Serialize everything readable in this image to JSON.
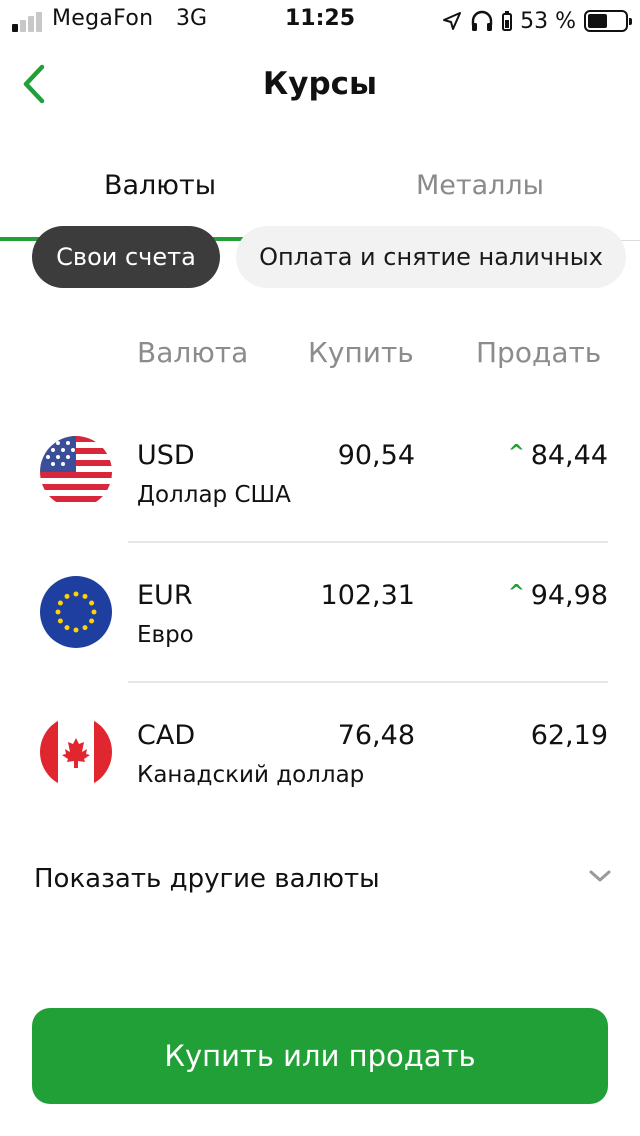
{
  "status_bar": {
    "carrier": "MegaFon",
    "network": "3G",
    "time": "11:25",
    "battery": "53 %",
    "battery_level": 0.53,
    "signal_bars_filled": 1,
    "icons": [
      "location-arrow-icon",
      "headphones-icon",
      "battery-icon"
    ]
  },
  "header": {
    "title": "Курсы",
    "back_icon": "chevron-left-icon"
  },
  "tabs": [
    {
      "label": "Валюты",
      "active": true
    },
    {
      "label": "Металлы",
      "active": false
    }
  ],
  "filters": [
    {
      "label": "Свои счета",
      "selected": true
    },
    {
      "label": "Оплата и снятие наличных",
      "selected": false
    }
  ],
  "table": {
    "columns": {
      "currency": "Валюта",
      "buy": "Купить",
      "sell": "Продать"
    },
    "rows": [
      {
        "code": "USD",
        "name": "Доллар США",
        "buy": "90,54",
        "sell": "84,44",
        "trend": "up",
        "flag": "us-flag-icon"
      },
      {
        "code": "EUR",
        "name": "Евро",
        "buy": "102,31",
        "sell": "94,98",
        "trend": "up",
        "flag": "eu-flag-icon"
      },
      {
        "code": "CAD",
        "name": "Канадский доллар",
        "buy": "76,48",
        "sell": "62,19",
        "trend": "none",
        "flag": "canada-flag-icon"
      }
    ]
  },
  "show_more": {
    "label": "Показать другие валюты",
    "icon": "chevron-down-icon"
  },
  "cta": {
    "label": "Купить или продать"
  },
  "colors": {
    "accent": "#21a038",
    "chip_selected": "#3c3c3c",
    "chip_normal": "#f2f2f2",
    "muted_text": "#8c8c8c"
  }
}
